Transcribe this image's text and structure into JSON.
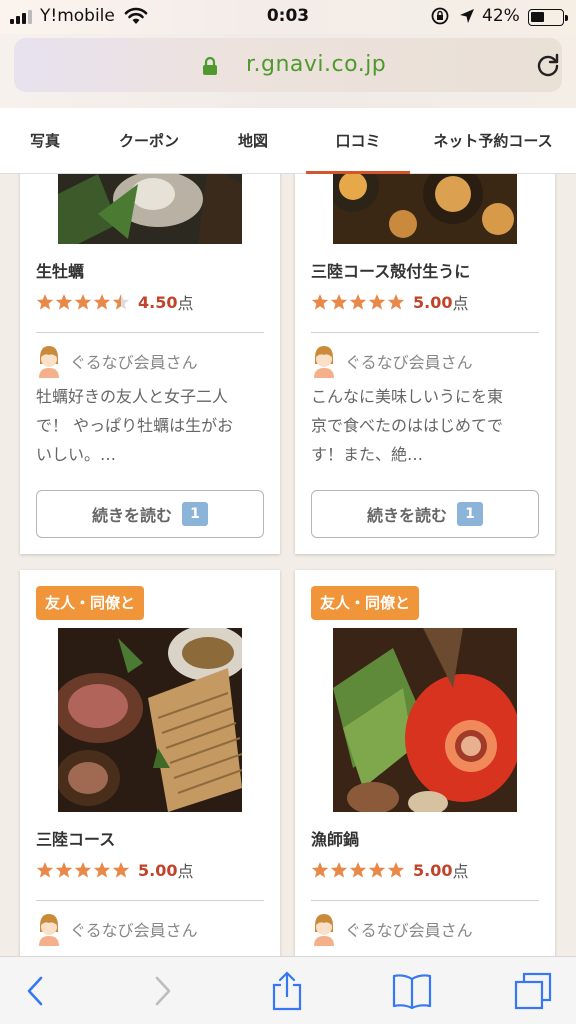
{
  "status_bar": {
    "carrier": "Y!mobile",
    "time": "0:03",
    "battery_percent": "42%",
    "battery_level": 0.42,
    "icons": [
      "signal-icon",
      "wifi-icon",
      "rotation-lock-icon",
      "location-icon",
      "battery-icon"
    ]
  },
  "browser": {
    "url": "r.gnavi.co.jp",
    "url_color": "#4e9a2f",
    "icons": [
      "lock-icon",
      "reload-icon"
    ]
  },
  "tabs": [
    {
      "label": "写真"
    },
    {
      "label": "クーポン"
    },
    {
      "label": "地図"
    },
    {
      "label": "口コミ",
      "active": true
    },
    {
      "label": "ネット予約コース"
    }
  ],
  "accent_color": "#d4552b",
  "cards": [
    {
      "dish": "生牡蠣",
      "rating": 4.5,
      "score": "4.50",
      "unit": "点",
      "reviewer": "ぐるなび会員さん",
      "review_lines": [
        "牡蠣好きの友人と女子二人",
        "で！ やっぱり牡蠣は生がお",
        "いしい。…"
      ],
      "more_label": "続きを読む",
      "more_count": "1"
    },
    {
      "dish": "三陸コース殻付生うに",
      "rating": 5,
      "score": "5.00",
      "unit": "点",
      "reviewer": "ぐるなび会員さん",
      "review_lines": [
        "こんなに美味しいうにを東",
        "京で食べたのははじめてで",
        "す！また、絶…"
      ],
      "more_label": "続きを読む",
      "more_count": "1"
    },
    {
      "tag": "友人・同僚と",
      "dish": "三陸コース",
      "rating": 5,
      "score": "5.00",
      "unit": "点",
      "reviewer": "ぐるなび会員さん"
    },
    {
      "tag": "友人・同僚と",
      "dish": "漁師鍋",
      "rating": 5,
      "score": "5.00",
      "unit": "点",
      "reviewer": "ぐるなび会員さん"
    }
  ],
  "star_color": "#e8894a",
  "score_color": "#c0432a",
  "tag_color": "#f0953a",
  "toolbar": {
    "icons": [
      "back-icon",
      "forward-icon",
      "share-icon",
      "bookmarks-icon",
      "tabs-icon"
    ]
  }
}
